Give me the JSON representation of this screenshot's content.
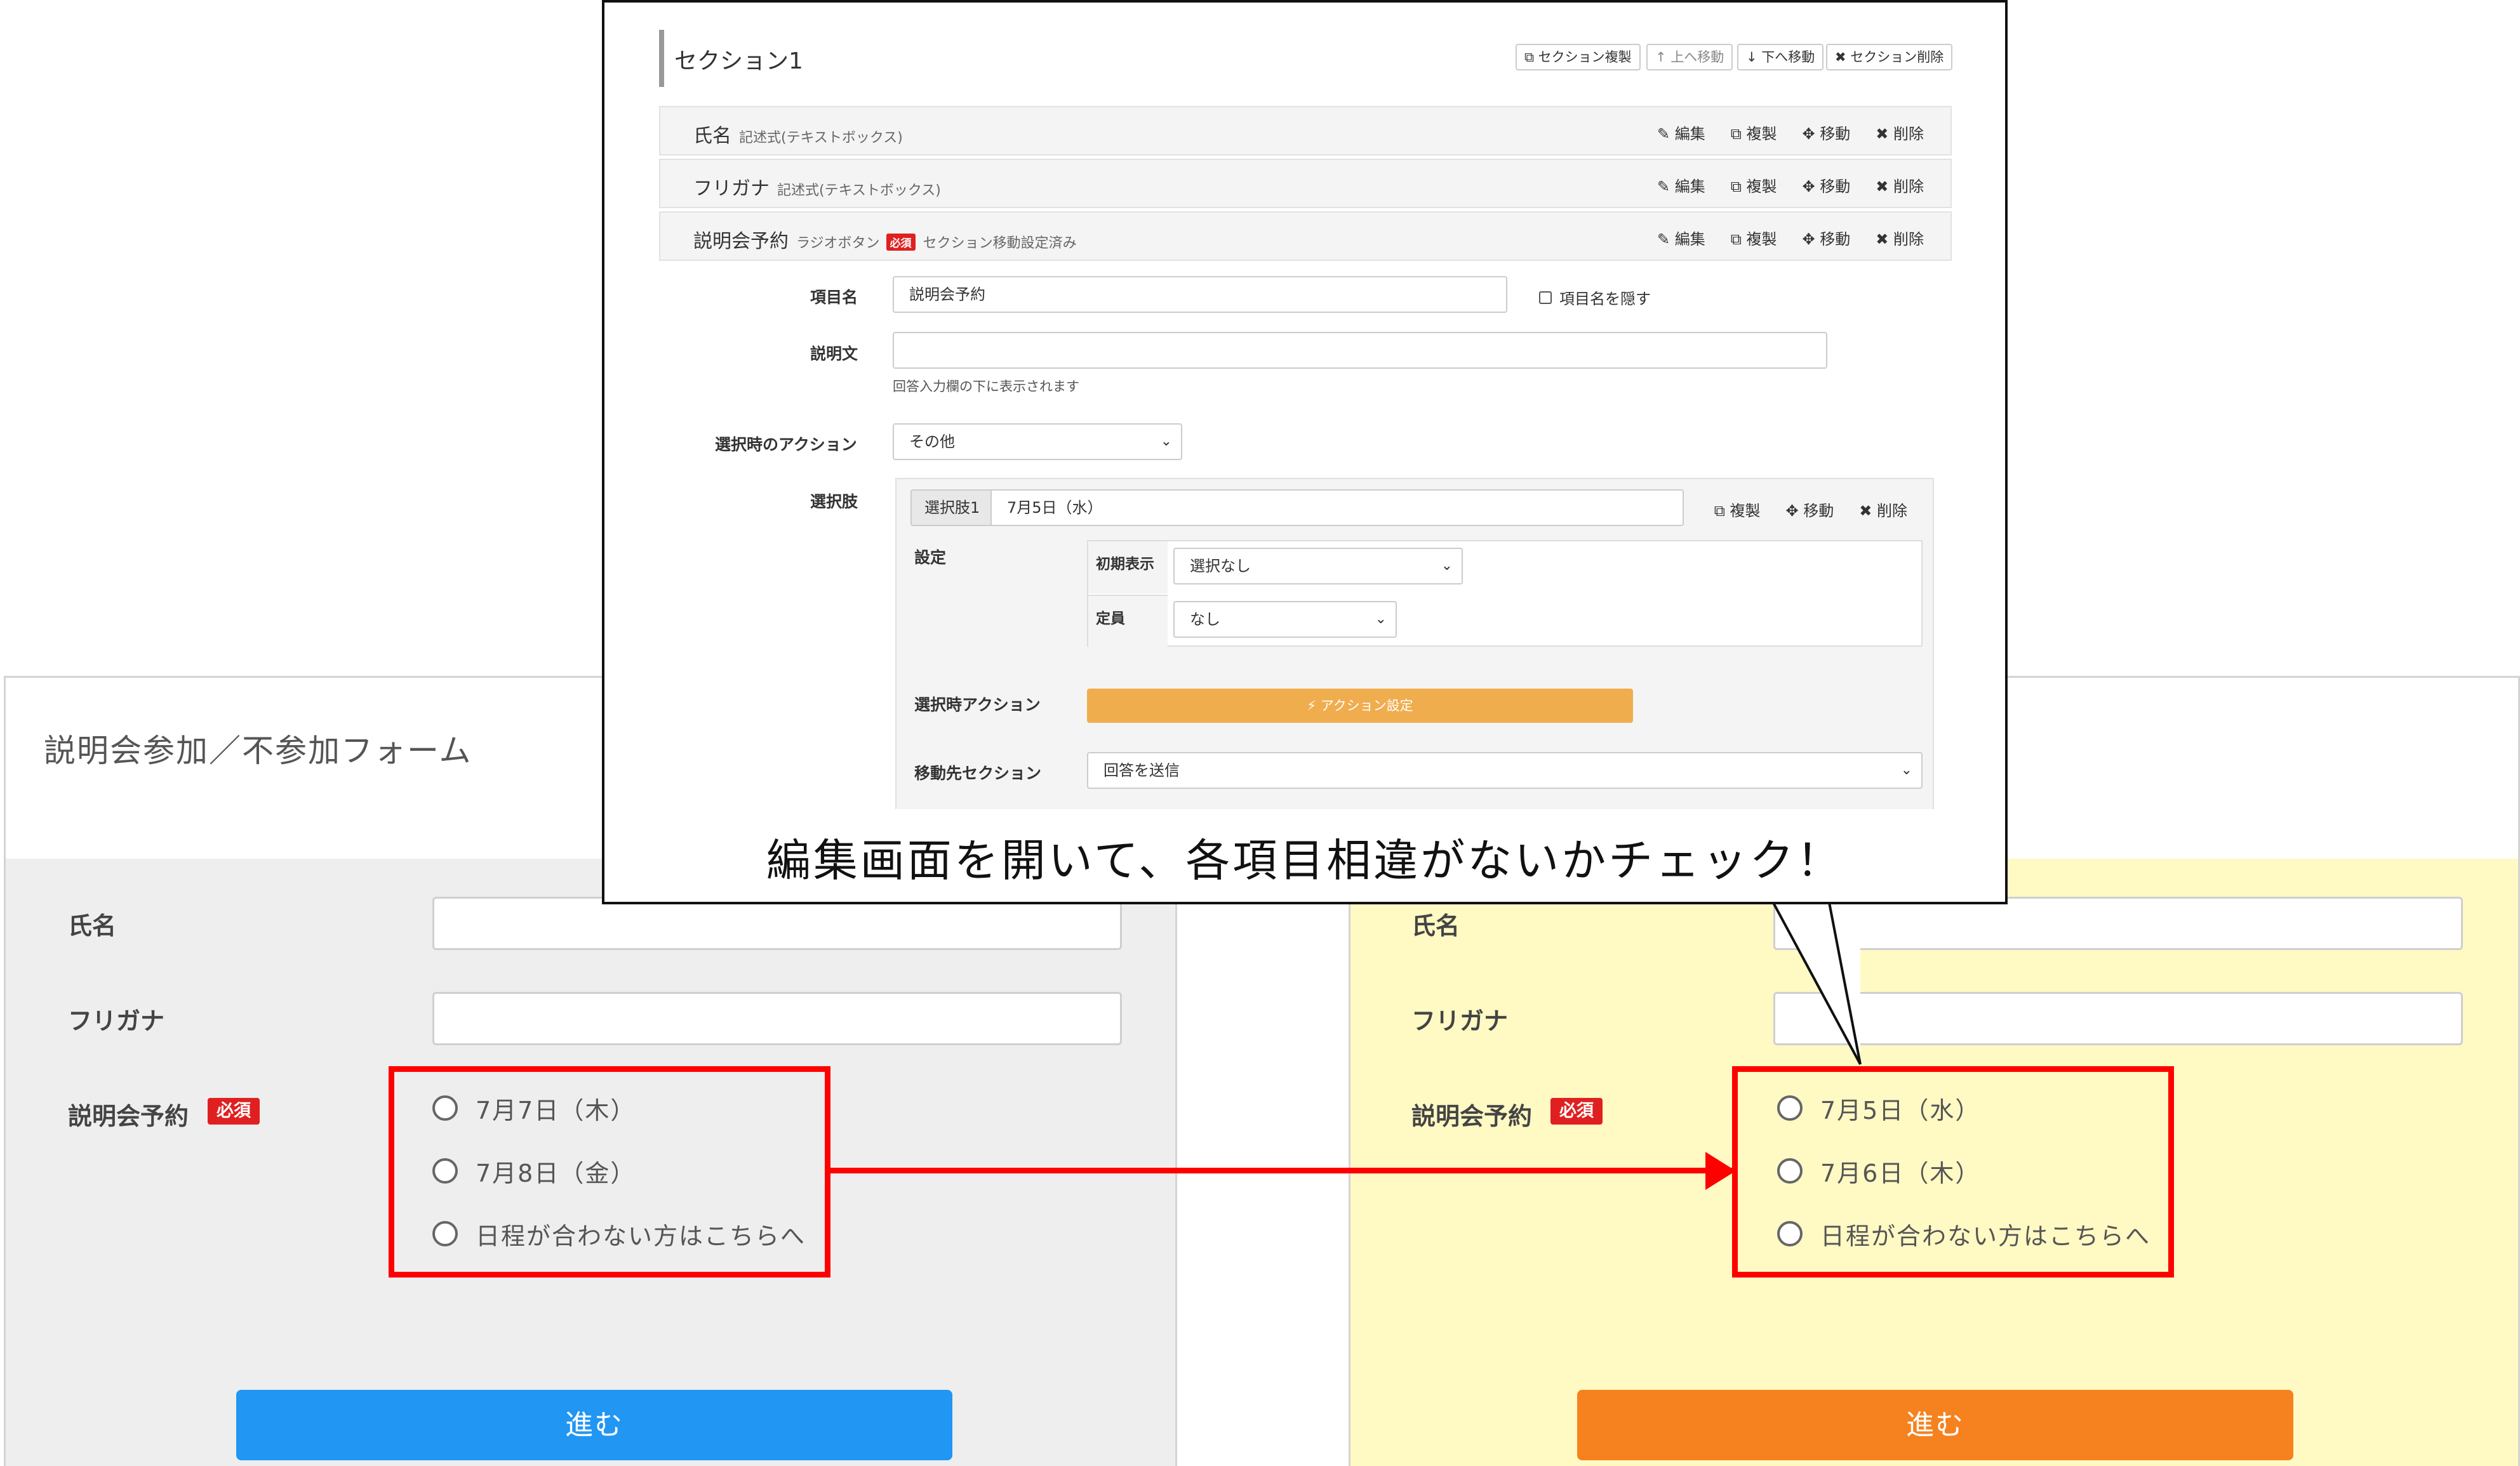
{
  "left_form": {
    "title": "説明会参加／不参加フォーム",
    "fields": {
      "name_label": "氏名",
      "furigana_label": "フリガナ",
      "reservation_label": "説明会予約",
      "required_badge": "必須"
    },
    "options": [
      "7月7日（木）",
      "7月8日（金）",
      "日程が合わない方はこちらへ"
    ],
    "submit_label": "進む",
    "submit_color": "#2196f3",
    "background_color": "#eeeeee"
  },
  "right_form": {
    "fields": {
      "name_label": "氏名",
      "furigana_label": "フリガナ",
      "reservation_label": "説明会予約",
      "required_badge": "必須"
    },
    "options": [
      "7月5日（水）",
      "7月6日（木）",
      "日程が合わない方はこちらへ"
    ],
    "submit_label": "進む",
    "submit_color": "#f5821f",
    "background_color": "#fff9c4"
  },
  "callout": {
    "text": "編集画面を開いて、各項目相違がないかチェック！"
  },
  "editor": {
    "section_title": "セクション1",
    "section_buttons": {
      "duplicate": "セクション複製",
      "move_up": "上へ移動",
      "move_down": "下へ移動",
      "delete": "セクション削除"
    },
    "questions": [
      {
        "name": "氏名",
        "type": "記述式(テキストボックス)"
      },
      {
        "name": "フリガナ",
        "type": "記述式(テキストボックス)"
      },
      {
        "name": "説明会予約",
        "type": "ラジオボタン",
        "badge": "必須",
        "note": "セクション移動設定済み"
      }
    ],
    "question_actions": {
      "edit": "編集",
      "duplicate": "複製",
      "move": "移動",
      "delete": "削除"
    },
    "item_name_label": "項目名",
    "item_name_value": "説明会予約",
    "hide_item_name_label": "項目名を隠す",
    "description_label": "説明文",
    "description_hint": "回答入力欄の下に表示されます",
    "selection_action_label": "選択時のアクション",
    "selection_action_value": "その他",
    "choices_label": "選択肢",
    "choice_prefix": "選択肢1",
    "choice_value": "7月5日（水）",
    "settings_label": "設定",
    "initial_display_label": "初期表示",
    "initial_display_value": "選択なし",
    "capacity_label": "定員",
    "capacity_value": "なし",
    "choice_action_label": "選択時アクション",
    "action_settings_button": "アクション設定",
    "destination_section_label": "移動先セクション",
    "destination_section_value": "回答を送信"
  },
  "icons": {
    "edit": "pencil-icon",
    "duplicate": "copy-icon",
    "move": "move-arrows-icon",
    "delete": "x-icon",
    "up": "arrow-up-icon",
    "down": "arrow-down-icon",
    "bolt": "bolt-icon",
    "radio": "radio-circle-icon"
  },
  "colors": {
    "highlight_box": "#ff0000",
    "required_badge": "#e02020",
    "action_button": "#f0ad4e"
  }
}
